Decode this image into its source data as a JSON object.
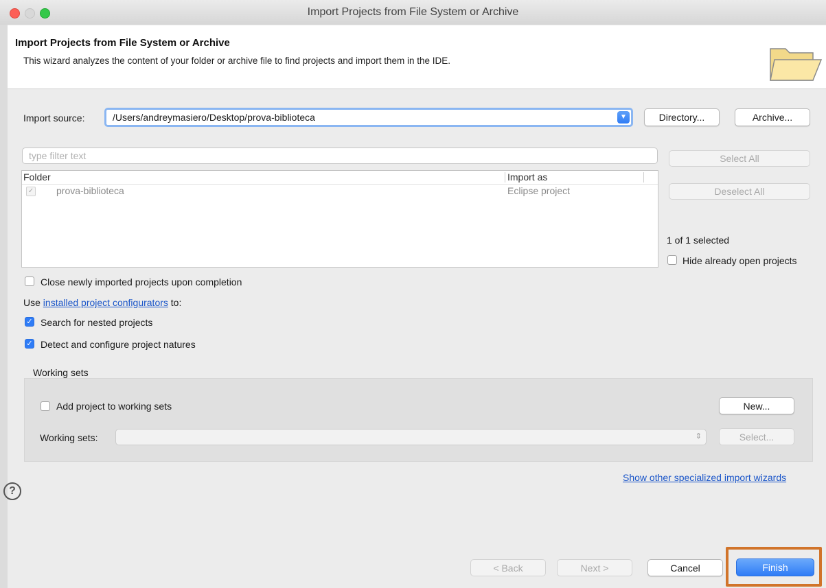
{
  "window": {
    "title": "Import Projects from File System or Archive"
  },
  "header": {
    "title": "Import Projects from File System or Archive",
    "description": "This wizard analyzes the content of your folder or archive file to find projects and import them in the IDE."
  },
  "source": {
    "label": "Import source:",
    "value": "/Users/andreymasiero/Desktop/prova-biblioteca",
    "directory_button": "Directory...",
    "archive_button": "Archive..."
  },
  "filter": {
    "placeholder": "type filter text"
  },
  "table": {
    "columns": [
      "Folder",
      "Import as"
    ],
    "rows": [
      {
        "folder": "prova-biblioteca",
        "import_as": "Eclipse project",
        "checked": true
      }
    ]
  },
  "side": {
    "select_all": "Select All",
    "deselect_all": "Deselect All",
    "selection_count": "1 of 1 selected",
    "hide_open_label": "Hide already open projects"
  },
  "options": {
    "close_label": "Close newly imported projects upon completion",
    "use_prefix": "Use",
    "configurators_link": "installed project configurators",
    "use_suffix": "to:",
    "nested_label": "Search for nested projects",
    "natures_label": "Detect and configure project natures"
  },
  "working_sets": {
    "group_label": "Working sets",
    "add_label": "Add project to working sets",
    "new_button": "New...",
    "sets_label": "Working sets:",
    "select_button": "Select..."
  },
  "other_wizards_link": "Show other specialized import wizards",
  "footer": {
    "help_symbol": "?",
    "back_button": "< Back",
    "next_button": "Next >",
    "cancel_button": "Cancel",
    "finish_button": "Finish"
  },
  "colors": {
    "accent": "#2f7cf6",
    "highlight": "#d1742a",
    "link": "#1b56c9"
  }
}
